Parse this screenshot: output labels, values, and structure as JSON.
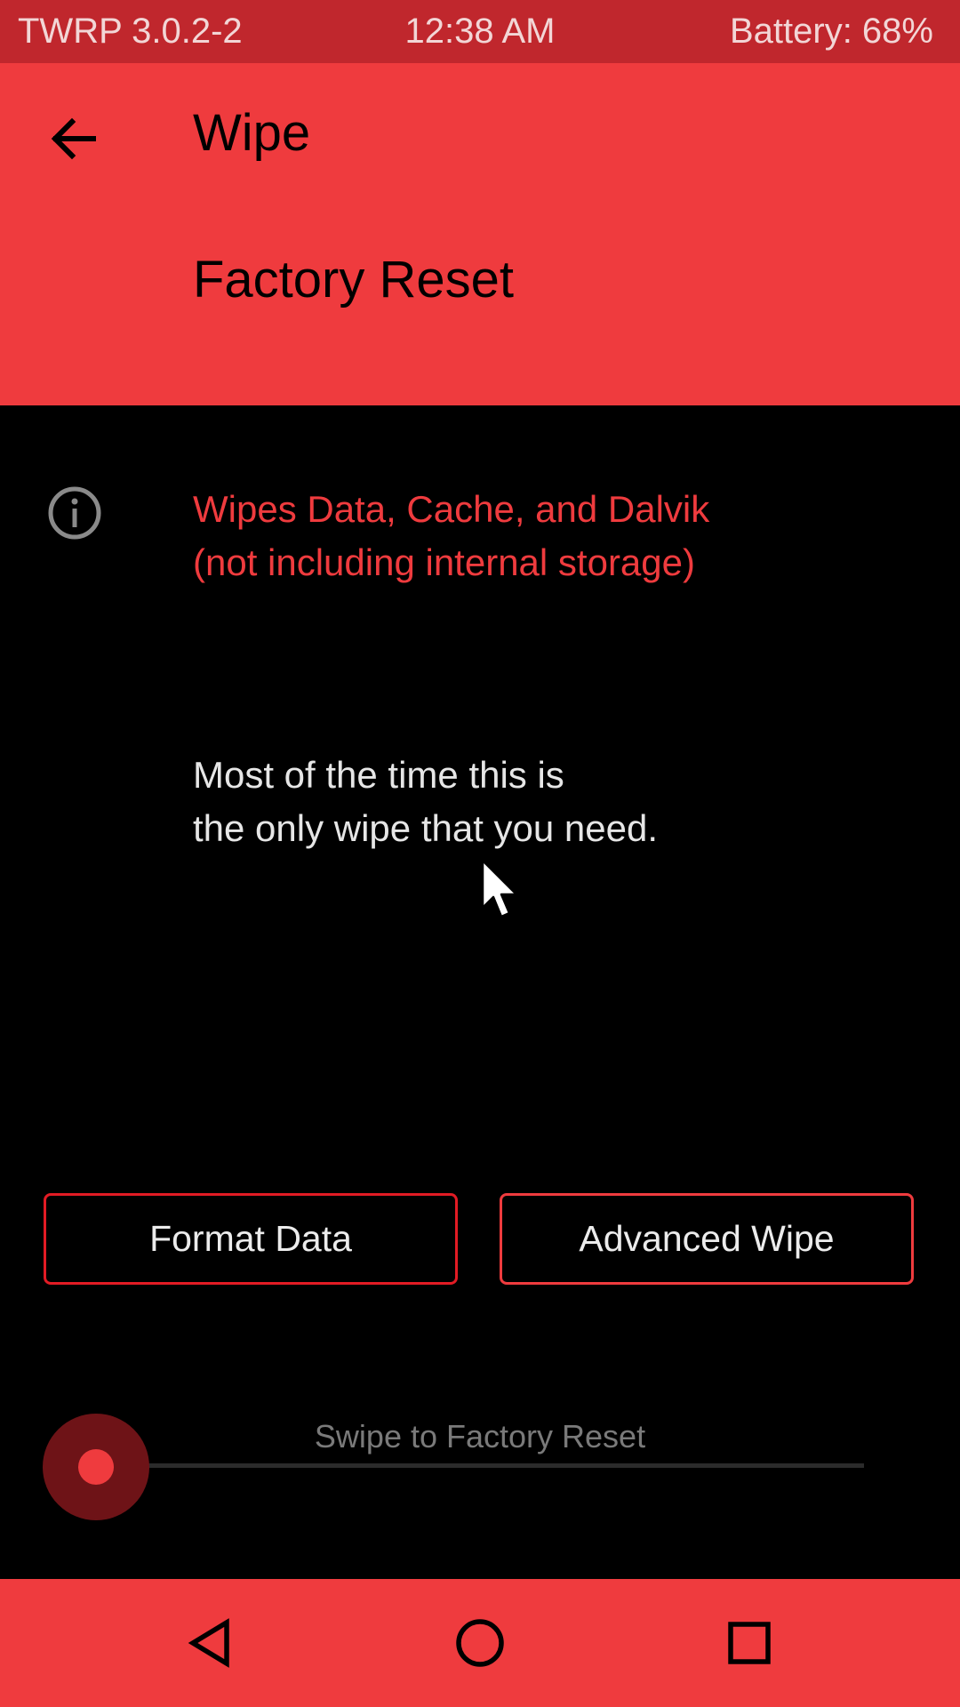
{
  "status_bar": {
    "version": "TWRP 3.0.2-2",
    "time": "12:38 AM",
    "battery": "Battery: 68%"
  },
  "header": {
    "back_icon": "arrow-left-icon",
    "title": "Wipe",
    "subtitle": "Factory Reset"
  },
  "info": {
    "icon": "info-icon",
    "line1": "Wipes Data, Cache, and Dalvik",
    "line2": "(not including internal storage)"
  },
  "note": {
    "line1": "Most of the time this is",
    "line2": "the only wipe that you need."
  },
  "buttons": {
    "format_data": "Format Data",
    "advanced_wipe": "Advanced Wipe"
  },
  "swipe": {
    "label": "Swipe to Factory Reset",
    "progress": 0
  },
  "nav": {
    "back_icon": "triangle-back-icon",
    "home_icon": "circle-home-icon",
    "recent_icon": "square-recents-icon"
  },
  "colors": {
    "accent": "#ef3b3e",
    "status_bar": "#c0272d",
    "button_border": "#e21b24",
    "background": "#000000",
    "swipe_handle": "#6e1317"
  }
}
